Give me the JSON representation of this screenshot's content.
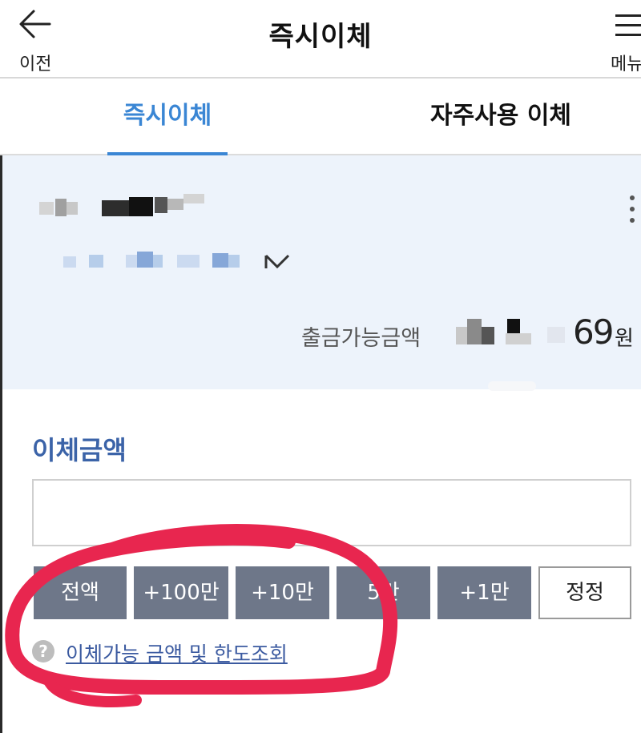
{
  "header": {
    "back_label": "이전",
    "title": "즉시이체",
    "menu_label": "메뉴"
  },
  "tabs": [
    {
      "label": "즉시이체",
      "active": true
    },
    {
      "label": "자주사용 이체",
      "active": false
    }
  ],
  "account": {
    "available_label": "출금가능금액",
    "available_amount_visible": "69",
    "currency": "원"
  },
  "transfer": {
    "amount_label": "이체금액",
    "amount_value": "",
    "quick_buttons": [
      "전액",
      "+100만",
      "+10만",
      "5만",
      "+1만"
    ],
    "correct_label": "정정",
    "help_link": "이체가능 금액 및 한도조회"
  },
  "colors": {
    "accent": "#3a86d4",
    "label_blue": "#3b63a8",
    "button_gray": "#6e7789",
    "panel_bg": "#edf3fb",
    "annotation_red": "#e8264f"
  }
}
